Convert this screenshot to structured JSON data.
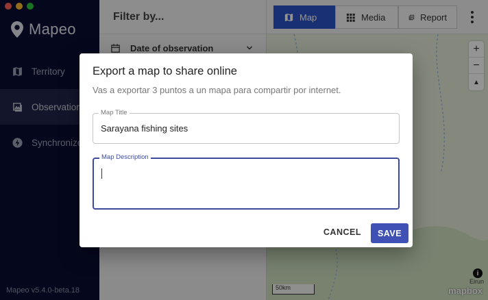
{
  "app": {
    "name": "Mapeo",
    "version": "Mapeo v5.4.0-beta.18"
  },
  "sidebar": {
    "items": [
      {
        "label": "Territory",
        "icon": "map-icon"
      },
      {
        "label": "Observations",
        "icon": "photo-icon"
      },
      {
        "label": "Synchronize",
        "icon": "bolt-icon"
      }
    ],
    "active_index": 1
  },
  "filter": {
    "title": "Filter by...",
    "rows": [
      {
        "label": "Date of observation"
      }
    ]
  },
  "toolbar": {
    "tabs": [
      {
        "label": "Map",
        "icon": "map-icon"
      },
      {
        "label": "Media",
        "icon": "grid-icon"
      },
      {
        "label": "Report",
        "icon": "report-icon"
      }
    ],
    "active_tab": "Map"
  },
  "map": {
    "zoom_in": "+",
    "zoom_out": "−",
    "compass": "▲",
    "scale_label": "50km",
    "attribution_logo": "mapbox",
    "place_label": "Eirun"
  },
  "dialog": {
    "title": "Export a map to share online",
    "subtitle": "Vas a exportar 3 puntos a un mapa para compartir por internet.",
    "fields": {
      "title_label": "Map Title",
      "title_value": "Sarayana fishing sites",
      "description_label": "Map Description",
      "description_value": ""
    },
    "cancel_label": "CANCEL",
    "save_label": "SAVE"
  },
  "colors": {
    "sidebar_bg": "#0a0d33",
    "accent": "#3f51b5",
    "tab_active": "#2c55c9"
  }
}
